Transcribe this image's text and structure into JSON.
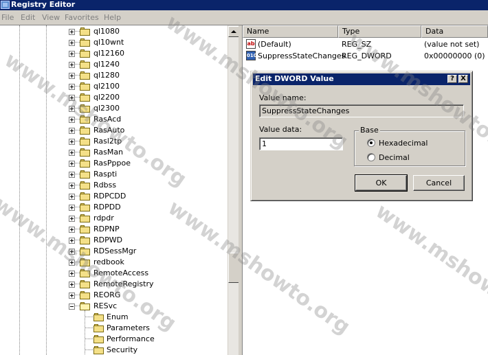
{
  "window": {
    "title": "Registry Editor"
  },
  "menu": [
    "File",
    "Edit",
    "View",
    "Favorites",
    "Help"
  ],
  "tree": {
    "collapsed_items": [
      "ql1080",
      "ql10wnt",
      "ql12160",
      "ql1240",
      "ql1280",
      "ql2100",
      "ql2200",
      "ql2300",
      "RasAcd",
      "RasAuto",
      "Rasl2tp",
      "RasMan",
      "RasPppoe",
      "Raspti",
      "Rdbss",
      "RDPCDD",
      "RDPDD",
      "rdpdr",
      "RDPNP",
      "RDPWD",
      "RDSessMgr",
      "redbook",
      "RemoteAccess",
      "RemoteRegistry",
      "REORG"
    ],
    "expanded_item": "RESvc",
    "children": [
      "Enum",
      "Parameters",
      "Performance",
      "Security"
    ]
  },
  "list": {
    "headers": {
      "name": "Name",
      "type": "Type",
      "data": "Data"
    },
    "rows": [
      {
        "icon": "ab",
        "name": "(Default)",
        "type": "REG_SZ",
        "data": "(value not set)"
      },
      {
        "icon": "010",
        "name": "SuppressStateChanges",
        "type": "REG_DWORD",
        "data": "0x00000000 (0)"
      }
    ]
  },
  "dialog": {
    "title": "Edit DWORD Value",
    "help_btn": "?",
    "close_btn": "X",
    "value_name_label": "Value name:",
    "value_name": "SuppressStateChanges",
    "value_data_label": "Value data:",
    "value_data": "1",
    "base_label": "Base",
    "hex_label": "Hexadecimal",
    "dec_label": "Decimal",
    "selected_base": "Hexadecimal",
    "ok": "OK",
    "cancel": "Cancel"
  },
  "watermark": "www.mshowto.org"
}
